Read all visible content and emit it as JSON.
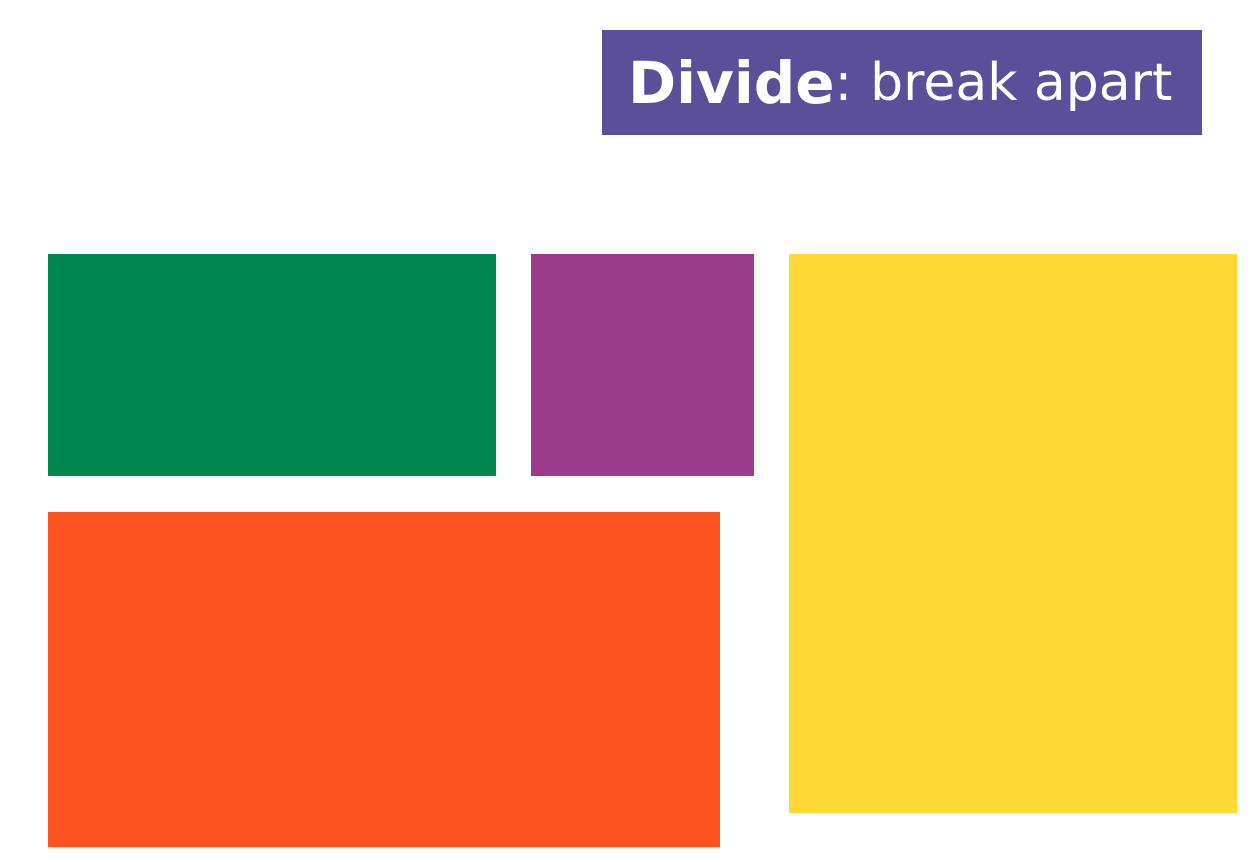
{
  "title": {
    "keyword": "Divide",
    "separator": ":",
    "description": "break apart",
    "background": "#5a4f98"
  },
  "blocks": [
    {
      "id": "green",
      "color": "#008651"
    },
    {
      "id": "purple",
      "color": "#9a3c8b"
    },
    {
      "id": "yellow",
      "color": "#fed834"
    },
    {
      "id": "orange",
      "color": "#fe521f"
    }
  ]
}
